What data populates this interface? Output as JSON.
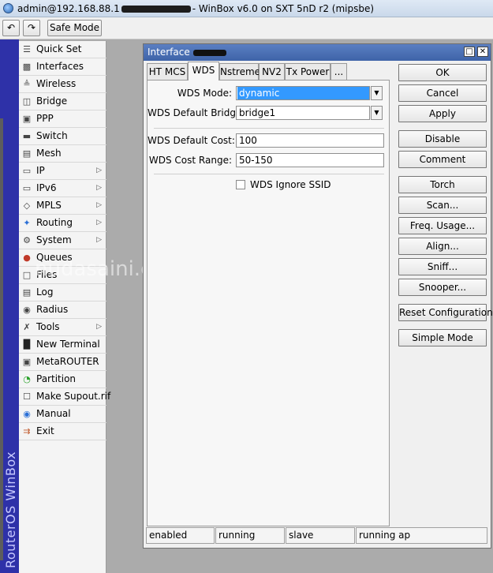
{
  "window": {
    "title_prefix": "admin@192.168.88.1",
    "title_suffix": "- WinBox v6.0 on SXT 5nD r2 (mipsbe)"
  },
  "toolbar": {
    "undo_icon": "undo-icon",
    "redo_icon": "redo-icon",
    "safe_mode": "Safe Mode"
  },
  "brand": {
    "text": "RouterOS WinBox"
  },
  "watermark": "nudasaini.com.np",
  "sidebar": {
    "items": [
      {
        "label": "Quick Set",
        "icon": "quick-set-icon",
        "submenu": false
      },
      {
        "label": "Interfaces",
        "icon": "interfaces-icon",
        "submenu": false
      },
      {
        "label": "Wireless",
        "icon": "wireless-icon",
        "submenu": false
      },
      {
        "label": "Bridge",
        "icon": "bridge-icon",
        "submenu": false
      },
      {
        "label": "PPP",
        "icon": "ppp-icon",
        "submenu": false
      },
      {
        "label": "Switch",
        "icon": "switch-icon",
        "submenu": false
      },
      {
        "label": "Mesh",
        "icon": "mesh-icon",
        "submenu": false
      },
      {
        "label": "IP",
        "icon": "ip-icon",
        "submenu": true
      },
      {
        "label": "IPv6",
        "icon": "ipv6-icon",
        "submenu": true
      },
      {
        "label": "MPLS",
        "icon": "mpls-icon",
        "submenu": true
      },
      {
        "label": "Routing",
        "icon": "routing-icon",
        "submenu": true
      },
      {
        "label": "System",
        "icon": "system-icon",
        "submenu": true
      },
      {
        "label": "Queues",
        "icon": "queues-icon",
        "submenu": false
      },
      {
        "label": "Files",
        "icon": "files-icon",
        "submenu": false
      },
      {
        "label": "Log",
        "icon": "log-icon",
        "submenu": false
      },
      {
        "label": "Radius",
        "icon": "radius-icon",
        "submenu": false
      },
      {
        "label": "Tools",
        "icon": "tools-icon",
        "submenu": true
      },
      {
        "label": "New Terminal",
        "icon": "terminal-icon",
        "submenu": false
      },
      {
        "label": "MetaROUTER",
        "icon": "metarouter-icon",
        "submenu": false
      },
      {
        "label": "Partition",
        "icon": "partition-icon",
        "submenu": false
      },
      {
        "label": "Make Supout.rif",
        "icon": "supout-icon",
        "submenu": false
      },
      {
        "label": "Manual",
        "icon": "manual-icon",
        "submenu": false
      },
      {
        "label": "Exit",
        "icon": "exit-icon",
        "submenu": false
      }
    ]
  },
  "dialog": {
    "title": "Interface",
    "restore_glyph": "□",
    "close_glyph": "✕",
    "tabs": [
      "HT MCS",
      "WDS",
      "Nstreme",
      "NV2",
      "Tx Power",
      "..."
    ],
    "active_tab": "WDS",
    "fields": {
      "wds_mode_label": "WDS Mode:",
      "wds_mode_value": "dynamic",
      "wds_default_bridge_label": "WDS Default Bridge:",
      "wds_default_bridge_value": "bridge1",
      "wds_default_cost_label": "WDS Default Cost:",
      "wds_default_cost_value": "100",
      "wds_cost_range_label": "WDS Cost Range:",
      "wds_cost_range_value": "50-150",
      "wds_ignore_ssid_label": "WDS Ignore SSID",
      "wds_ignore_ssid_checked": false
    },
    "buttons": [
      "OK",
      "Cancel",
      "Apply",
      "Disable",
      "Comment",
      "Torch",
      "Scan...",
      "Freq. Usage...",
      "Align...",
      "Sniff...",
      "Snooper...",
      "Reset Configuration",
      "Simple Mode"
    ],
    "status": [
      "enabled",
      "running",
      "slave",
      "running ap"
    ]
  },
  "colors": {
    "brand_strip": "#2e31a8",
    "dialog_title": "#4a6fb5",
    "selection": "#3399ff"
  }
}
